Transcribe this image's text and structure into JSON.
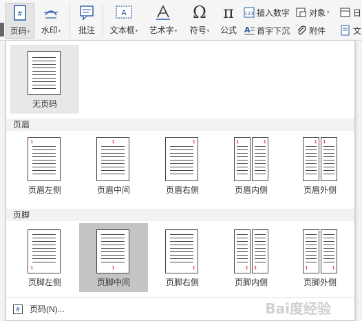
{
  "toolbar": {
    "page_number": "页码",
    "watermark": "水印",
    "comment": "批注",
    "textbox": "文本框",
    "wordart": "艺术字",
    "symbol": "符号",
    "formula": "公式",
    "insert_number": "插入数字",
    "object": "对象",
    "dropcap": "首字下沉",
    "attachment": "附件",
    "date_partial": "日",
    "doc_partial": "文",
    "dropdown_arrow": "▾"
  },
  "dropdown": {
    "no_page_number": "无页码",
    "header_section": "页眉",
    "footer_section": "页脚",
    "header_items": [
      {
        "label": "页眉左侧",
        "pos": "left"
      },
      {
        "label": "页眉中间",
        "pos": "center"
      },
      {
        "label": "页眉右侧",
        "pos": "right"
      },
      {
        "label": "页眉内侧",
        "pos": "inner"
      },
      {
        "label": "页眉外侧",
        "pos": "outer"
      }
    ],
    "footer_items": [
      {
        "label": "页脚左侧",
        "pos": "left"
      },
      {
        "label": "页脚中间",
        "pos": "center"
      },
      {
        "label": "页脚右侧",
        "pos": "right"
      },
      {
        "label": "页脚内侧",
        "pos": "inner"
      },
      {
        "label": "页脚外侧",
        "pos": "outer"
      }
    ],
    "page_number_dialog": "页码(N)...",
    "page_digit": "1"
  },
  "watermark_text": "Bai度经验"
}
